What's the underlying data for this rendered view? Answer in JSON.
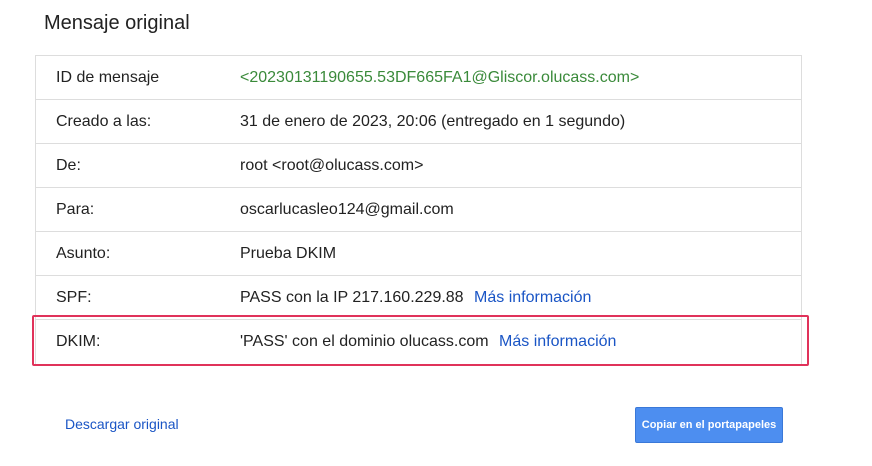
{
  "page": {
    "title": "Mensaje original"
  },
  "rows": [
    {
      "label": "ID de mensaje",
      "value": "<20230131190655.53DF665FA1@Gliscor.olucass.com>",
      "link": ""
    },
    {
      "label": "Creado a las:",
      "value": "31 de enero de 2023, 20:06 (entregado en 1 segundo)",
      "link": ""
    },
    {
      "label": "De:",
      "value": "root <root@olucass.com>",
      "link": ""
    },
    {
      "label": "Para:",
      "value": "oscarlucasleo124@gmail.com",
      "link": ""
    },
    {
      "label": "Asunto:",
      "value": "Prueba DKIM",
      "link": ""
    },
    {
      "label": "SPF:",
      "value": "PASS con la IP 217.160.229.88",
      "link": "Más información"
    },
    {
      "label": "DKIM:",
      "value": "'PASS' con el dominio olucass.com",
      "link": "Más información"
    }
  ],
  "footer": {
    "download_label": "Descargar original",
    "copy_label": "Copiar en el portapapeles"
  },
  "colors": {
    "highlight": "#e0325a",
    "link": "#1a55c5",
    "message_id": "#3a8a3a",
    "button": "#4d8ef0"
  }
}
